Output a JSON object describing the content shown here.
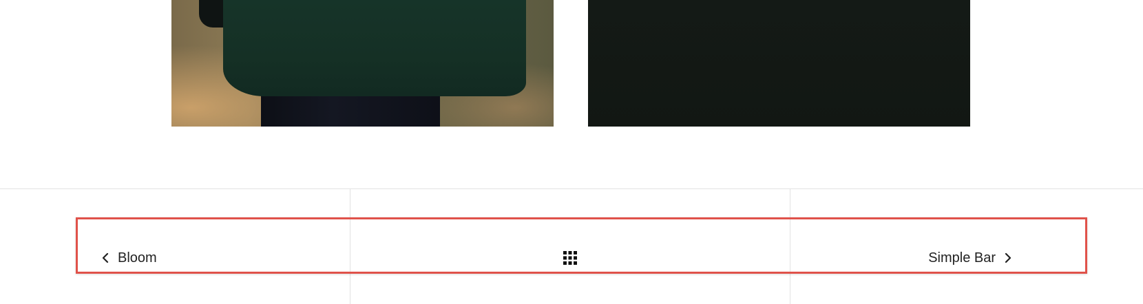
{
  "gallery": {
    "left_photo_icon": "photo-person-green-coat",
    "right_photo_icon": "photo-dark"
  },
  "post_navigation": {
    "prev_label": "Bloom",
    "next_label": "Simple Bar",
    "prev_icon": "chevron-left-icon",
    "next_icon": "chevron-right-icon",
    "grid_icon": "grid-icon"
  },
  "colors": {
    "highlight": "#e0524a",
    "divider": "#e2e2e2",
    "text": "#222222"
  }
}
